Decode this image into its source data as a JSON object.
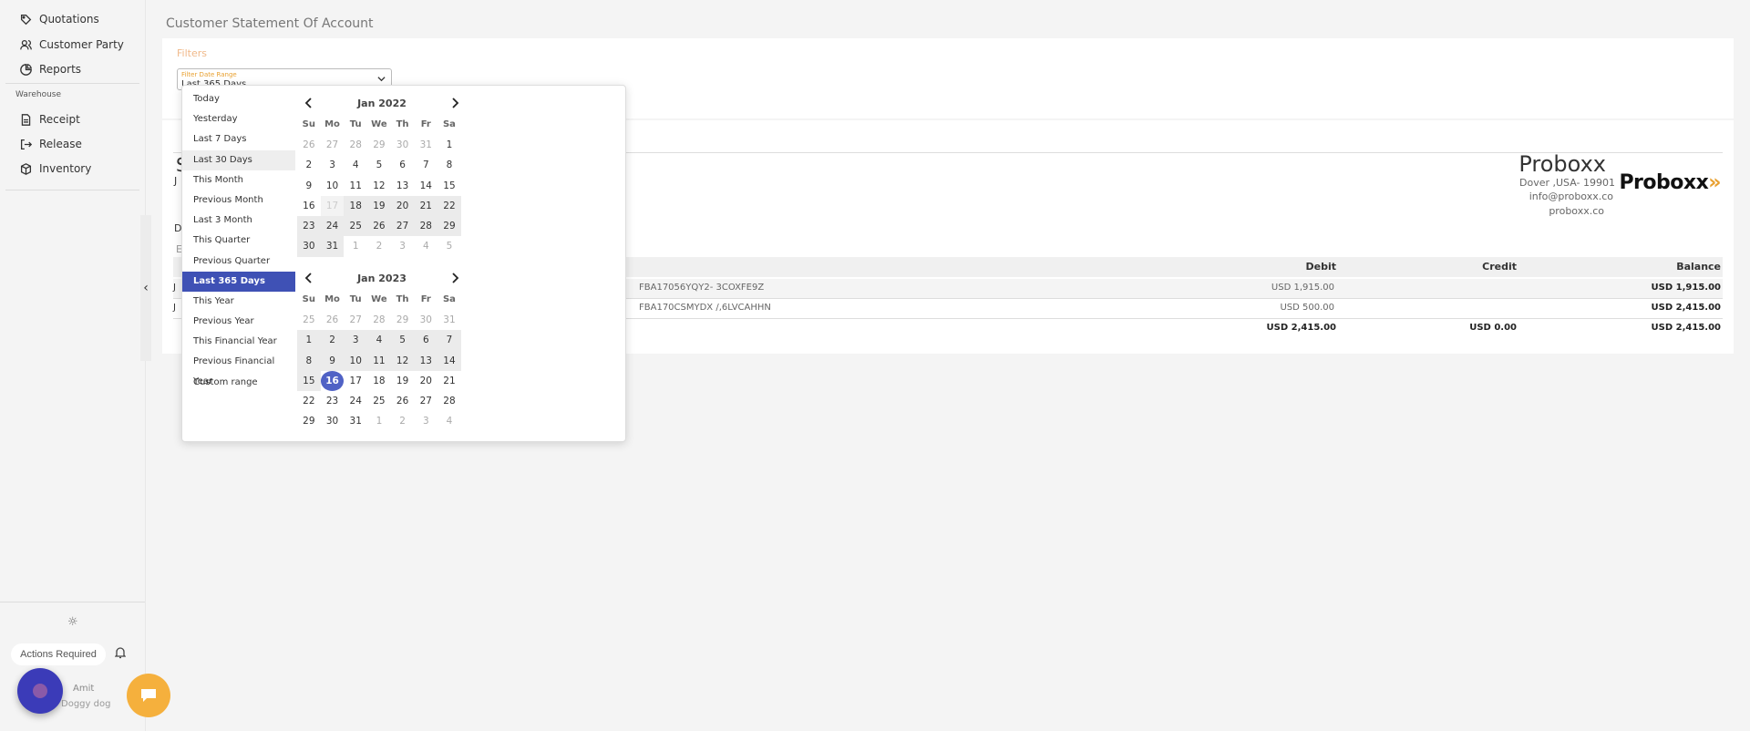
{
  "sidebar": {
    "items": [
      {
        "label": "Quotations",
        "icon": "tag-icon"
      },
      {
        "label": "Customer Party",
        "icon": "users-icon"
      },
      {
        "label": "Reports",
        "icon": "pie-chart-icon"
      }
    ],
    "warehouse_label": "Warehouse",
    "warehouse_items": [
      {
        "label": "Receipt",
        "icon": "file-icon"
      },
      {
        "label": "Release",
        "icon": "log-out-icon"
      },
      {
        "label": "Inventory",
        "icon": "box-icon"
      }
    ],
    "actions_label": "Actions Required",
    "user_name": "Amit",
    "user_sub": "Doggy dog"
  },
  "page": {
    "title": "Customer Statement Of Account",
    "filters_label": "Filters",
    "filter_field_label": "Filter Date Range",
    "filter_field_value": "Last 365 Days"
  },
  "company": {
    "name": "Proboxx",
    "address": "Dover ,USA- 19901",
    "email": "info@proboxx.co",
    "website": "proboxx.co",
    "logo_text": "Proboxx",
    "logo_mark": "»"
  },
  "report": {
    "left_fragments": [
      "S",
      "J",
      "D",
      "E",
      "D",
      "J",
      "J"
    ],
    "headers": {
      "debit": "Debit",
      "credit": "Credit",
      "balance": "Balance"
    },
    "rows": [
      {
        "ref": "FBA17056YQY2- 3COXFE9Z",
        "debit": "USD 1,915.00",
        "credit": "",
        "balance": "USD 1,915.00"
      },
      {
        "ref": "FBA170CSMYDX /,6LVCAHHN",
        "debit": "USD 500.00",
        "credit": "",
        "balance": "USD 2,415.00"
      }
    ],
    "totals": {
      "debit": "USD 2,415.00",
      "credit": "USD 0.00",
      "balance": "USD 2,415.00"
    }
  },
  "picker": {
    "ranges": [
      "Today",
      "Yesterday",
      "Last 7 Days",
      "Last 30 Days",
      "This Month",
      "Previous Month",
      "Last 3 Month",
      "This Quarter",
      "Previous Quarter",
      "Last 365 Days",
      "This Year",
      "Previous Year",
      "This Financial Year",
      "Previous Financial Year",
      "Custom range"
    ],
    "active_range": "Last 365 Days",
    "hover_range": "Last 30 Days",
    "weekdays": [
      "Su",
      "Mo",
      "Tu",
      "We",
      "Th",
      "Fr",
      "Sa"
    ],
    "calendars": [
      {
        "month": "Jan 2022",
        "weeks": [
          [
            "26",
            "27",
            "28",
            "29",
            "30",
            "31",
            "1"
          ],
          [
            "2",
            "3",
            "4",
            "5",
            "6",
            "7",
            "8"
          ],
          [
            "9",
            "10",
            "11",
            "12",
            "13",
            "14",
            "15"
          ],
          [
            "16",
            "17",
            "18",
            "19",
            "20",
            "21",
            "22"
          ],
          [
            "23",
            "24",
            "25",
            "26",
            "27",
            "28",
            "29"
          ],
          [
            "30",
            "31",
            "1",
            "2",
            "3",
            "4",
            "5"
          ]
        ]
      },
      {
        "month": "Jan 2023",
        "weeks": [
          [
            "25",
            "26",
            "27",
            "28",
            "29",
            "30",
            "31"
          ],
          [
            "1",
            "2",
            "3",
            "4",
            "5",
            "6",
            "7"
          ],
          [
            "8",
            "9",
            "10",
            "11",
            "12",
            "13",
            "14"
          ],
          [
            "15",
            "16",
            "17",
            "18",
            "19",
            "20",
            "21"
          ],
          [
            "22",
            "23",
            "24",
            "25",
            "26",
            "27",
            "28"
          ],
          [
            "29",
            "30",
            "31",
            "1",
            "2",
            "3",
            "4"
          ]
        ]
      }
    ]
  }
}
